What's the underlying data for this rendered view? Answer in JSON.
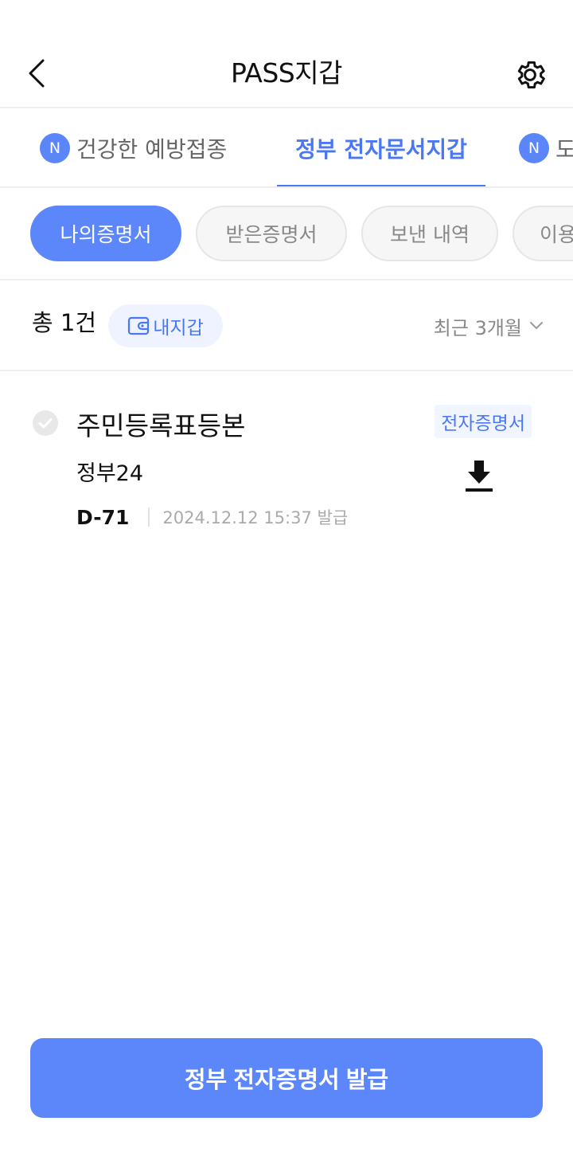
{
  "header": {
    "title": "PASS지갑",
    "back_icon": "chevron-left-icon",
    "settings_icon": "gear-icon"
  },
  "tabs": [
    {
      "label": "건강한 예방접종",
      "badge": "N",
      "active": false
    },
    {
      "label": "정부 전자문서지갑",
      "badge": "",
      "active": true
    },
    {
      "label": "도",
      "badge": "N",
      "active": false
    }
  ],
  "chips": [
    {
      "label": "나의증명서",
      "active": true
    },
    {
      "label": "받은증명서",
      "active": false
    },
    {
      "label": "보낸 내역",
      "active": false
    },
    {
      "label": "이용",
      "active": false
    }
  ],
  "summary": {
    "total": "총 1건",
    "wallet_label": "내지갑",
    "wallet_icon": "wallet-icon",
    "period": "최근 3개월",
    "period_icon": "chevron-down-icon"
  },
  "documents": [
    {
      "name": "주민등록표등본",
      "type": "전자증명서",
      "issuer": "정부24",
      "dday": "D-71",
      "issued_at": "2024.12.12 15:37 발급",
      "check_icon": "check-circle-icon",
      "download_icon": "download-icon"
    }
  ],
  "footer": {
    "issue_button": "정부 전자증명서 발급"
  },
  "colors": {
    "accent": "#5c87fb",
    "accent_text": "#4a78f5",
    "muted": "#888888"
  }
}
